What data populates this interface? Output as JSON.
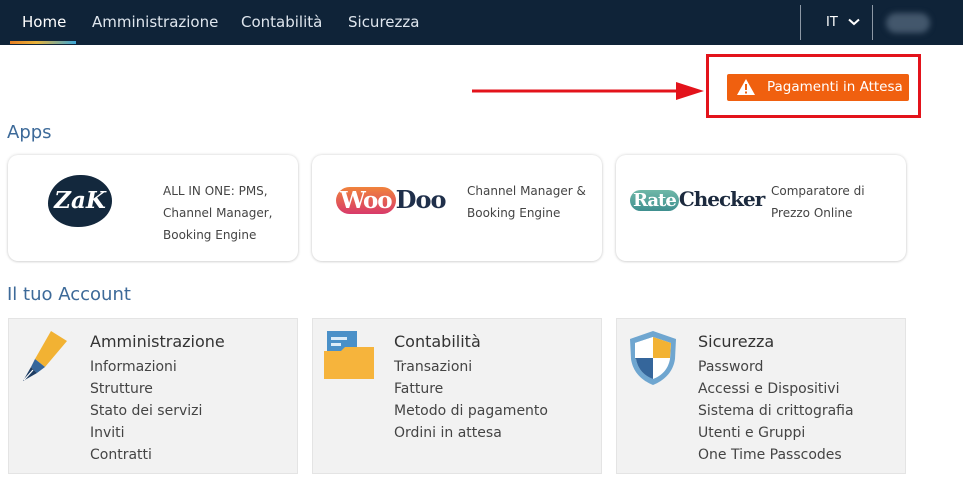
{
  "nav": {
    "tabs": [
      "Home",
      "Amministrazione",
      "Contabilità",
      "Sicurezza"
    ],
    "language": "IT"
  },
  "pending_payments": {
    "label": "Pagamenti in Attesa"
  },
  "apps": {
    "title": "Apps",
    "items": [
      {
        "logo": "ZaK",
        "description": [
          "ALL IN ONE: PMS,",
          "Channel Manager,",
          "Booking Engine"
        ]
      },
      {
        "logo_a": "Woo",
        "logo_b": "Doo",
        "description": [
          "Channel Manager &",
          "Booking Engine"
        ]
      },
      {
        "logo_a": "Rate",
        "logo_b": "Checker",
        "description": [
          "Comparatore di",
          "Prezzo Online"
        ]
      }
    ]
  },
  "account": {
    "title": "Il tuo Account",
    "cards": [
      {
        "title": "Amministrazione",
        "icon": "pen-nib-icon",
        "links": [
          "Informazioni",
          "Strutture",
          "Stato dei servizi",
          "Inviti",
          "Contratti"
        ]
      },
      {
        "title": "Contabilità",
        "icon": "folder-icon",
        "links": [
          "Transazioni",
          "Fatture",
          "Metodo di pagamento",
          "Ordini in attesa"
        ]
      },
      {
        "title": "Sicurezza",
        "icon": "shield-icon",
        "links": [
          "Password",
          "Accessi e Dispositivi",
          "Sistema di crittografia",
          "Utenti e Gruppi",
          "One Time Passcodes"
        ]
      }
    ]
  },
  "colors": {
    "nav_bg": "#0f2338",
    "accent_blue": "#3d6a99",
    "warning_orange": "#f0600f",
    "highlight_red": "#e3131b"
  }
}
